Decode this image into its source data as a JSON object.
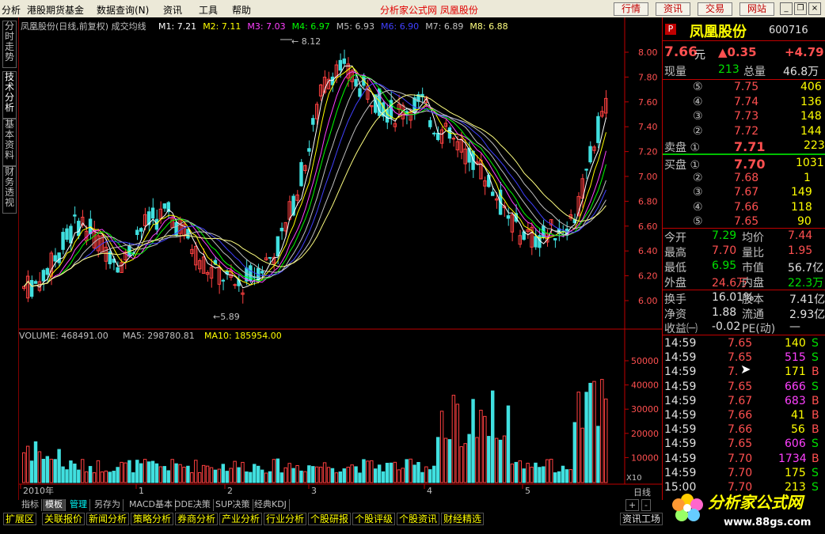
{
  "menu": {
    "items": [
      "分析",
      "港股期货基金",
      "数据查询(N)",
      "资讯",
      "工具",
      "帮助"
    ],
    "center_title": "分析家公式网  凤凰股份",
    "toolbar_buttons": [
      "行情",
      "资讯",
      "交易",
      "网站"
    ]
  },
  "left_tabs": [
    "分时走势",
    "技术分析",
    "基本资料",
    "财务透视"
  ],
  "chart": {
    "ma_header": "凤凰股份(日线,前复权) 成交均线",
    "ma_labels": [
      {
        "text": "M1: 7.21",
        "color": "#ffffff"
      },
      {
        "text": "M2: 7.11",
        "color": "#ffff00"
      },
      {
        "text": "M3: 7.03",
        "color": "#ff40ff"
      },
      {
        "text": "M4: 6.97",
        "color": "#00ff00"
      },
      {
        "text": "M5: 6.93",
        "color": "#c0c0c0"
      },
      {
        "text": "M6: 6.90",
        "color": "#4040ff"
      },
      {
        "text": "M7: 6.89",
        "color": "#c0c0c0"
      },
      {
        "text": "M8: 6.88",
        "color": "#ffff80"
      }
    ],
    "high_label": "8.12",
    "low_label": "5.89",
    "price_axis": [
      "8.00",
      "7.80",
      "7.60",
      "7.40",
      "7.20",
      "7.00",
      "6.80",
      "6.60",
      "6.40",
      "6.20",
      "6.00"
    ],
    "volume_header": {
      "vol": "VOLUME: 468491.00",
      "ma5": "MA5: 298780.81",
      "ma10": "MA10: 185954.00"
    },
    "volume_axis": [
      "50000",
      "40000",
      "30000",
      "20000",
      "10000"
    ],
    "volume_unit": "X10",
    "date_labels": [
      "2010年",
      "1",
      "2",
      "3",
      "4",
      "5"
    ],
    "period_label": "日线",
    "zoom_buttons": [
      "+",
      "-"
    ]
  },
  "bottom_tabs": [
    "指标",
    "模板",
    "管理",
    "另存为",
    "MACD基本",
    "DDE决策",
    "SUP决策",
    "经典KDJ"
  ],
  "status_tabs": [
    "扩展区",
    "关联报价",
    "新闻分析",
    "策略分析",
    "券商分析",
    "产业分析",
    "行业分析",
    "个股研报",
    "个股评级",
    "个股资讯",
    "财经精选",
    "资讯工场"
  ],
  "quote": {
    "badge": "P",
    "name": "凤凰股份",
    "code": "600716",
    "price": "7.66",
    "price_unit": "元",
    "change": "▲0.35",
    "change_pct": "+4.79",
    "now_vol_label": "现量",
    "now_vol": "213",
    "total_vol_label": "总量",
    "total_vol": "46.8万",
    "sells": [
      {
        "level": "⑤",
        "price": "7.75",
        "vol": "406"
      },
      {
        "level": "④",
        "price": "7.74",
        "vol": "136"
      },
      {
        "level": "③",
        "price": "7.73",
        "vol": "148"
      },
      {
        "level": "②",
        "price": "7.72",
        "vol": "144"
      },
      {
        "level": "卖盘 ①",
        "price": "7.71",
        "vol": "223"
      }
    ],
    "buys": [
      {
        "level": "买盘 ①",
        "price": "7.70",
        "vol": "1031"
      },
      {
        "level": "②",
        "price": "7.68",
        "vol": "1"
      },
      {
        "level": "③",
        "price": "7.67",
        "vol": "149"
      },
      {
        "level": "④",
        "price": "7.66",
        "vol": "118"
      },
      {
        "level": "⑤",
        "price": "7.65",
        "vol": "90"
      }
    ],
    "stats": [
      {
        "l1": "今开",
        "v1": "7.29",
        "c1": "grn",
        "l2": "均价",
        "v2": "7.44",
        "c2": "red"
      },
      {
        "l1": "最高",
        "v1": "7.70",
        "c1": "red",
        "l2": "量比",
        "v2": "1.95",
        "c2": "red"
      },
      {
        "l1": "最低",
        "v1": "6.95",
        "c1": "grn",
        "l2": "市值",
        "v2": "56.7亿",
        "c2": "wht"
      },
      {
        "l1": "外盘",
        "v1": "24.6万",
        "c1": "red",
        "l2": "内盘",
        "v2": "22.3万",
        "c2": "grn"
      }
    ],
    "stats2": [
      {
        "l1": "换手",
        "v1": "16.01%",
        "l2": "股本",
        "v2": "7.41亿"
      },
      {
        "l1": "净资",
        "v1": "1.88",
        "l2": "流通",
        "v2": "2.93亿"
      },
      {
        "l1": "收益㈠",
        "v1": "-0.02",
        "l2": "PE(动)",
        "v2": "—"
      }
    ],
    "ticks": [
      {
        "time": "14:59",
        "price": "7.65",
        "vol": "140",
        "side": "S"
      },
      {
        "time": "14:59",
        "price": "7.65",
        "vol": "515",
        "side": "S"
      },
      {
        "time": "14:59",
        "price": "7.",
        "vol": "171",
        "side": "B"
      },
      {
        "time": "14:59",
        "price": "7.65",
        "vol": "666",
        "side": "S"
      },
      {
        "time": "14:59",
        "price": "7.67",
        "vol": "683",
        "side": "B"
      },
      {
        "time": "14:59",
        "price": "7.66",
        "vol": "41",
        "side": "B"
      },
      {
        "time": "14:59",
        "price": "7.66",
        "vol": "56",
        "side": "B"
      },
      {
        "time": "14:59",
        "price": "7.65",
        "vol": "606",
        "side": "S"
      },
      {
        "time": "14:59",
        "price": "7.70",
        "vol": "1734",
        "side": "B"
      },
      {
        "time": "14:59",
        "price": "7.70",
        "vol": "175",
        "side": "S"
      },
      {
        "time": "15:00",
        "price": "7.70",
        "vol": "213",
        "side": "S"
      }
    ]
  },
  "logo": {
    "title": "分析家公式网",
    "url": "www.88gs.com"
  }
}
